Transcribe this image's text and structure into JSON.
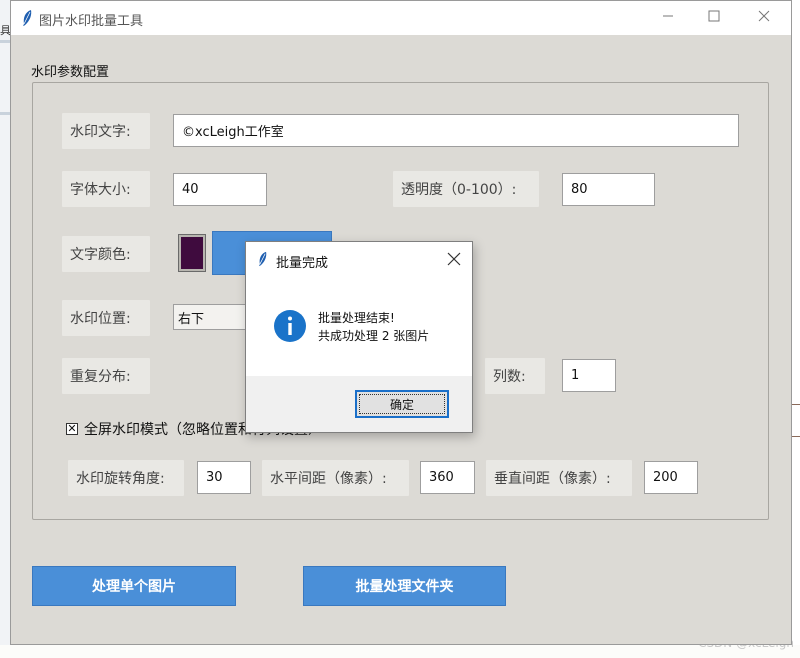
{
  "window": {
    "title": "图片水印批量工具",
    "minimize_icon": "minimize-icon",
    "maximize_icon": "maximize-icon",
    "close_icon": "close-icon"
  },
  "config": {
    "group_title": "水印参数配置",
    "text_label": "水印文字:",
    "text_value": "©xcLeigh工作室",
    "font_size_label": "字体大小:",
    "font_size_value": "40",
    "opacity_label": "透明度（0-100）:",
    "opacity_value": "80",
    "color_label": "文字颜色:",
    "color_swatch": "#3f0b3e",
    "position_label": "水印位置:",
    "position_value": "右下",
    "repeat_label": "重复分布:",
    "columns_label": "列数:",
    "columns_value": "1",
    "fullscreen_checked": true,
    "fullscreen_label": "全屏水印模式（忽略位置和行列设置）",
    "rotation_label": "水印旋转角度:",
    "rotation_value": "30",
    "h_spacing_label": "水平间距（像素）:",
    "h_spacing_value": "360",
    "v_spacing_label": "垂直间距（像素）:",
    "v_spacing_value": "200"
  },
  "actions": {
    "single_label": "处理单个图片",
    "batch_label": "批量处理文件夹"
  },
  "dialog": {
    "title": "批量完成",
    "line1": "批量处理结束!",
    "line2": "共成功处理 2 张图片",
    "ok_label": "确定"
  },
  "watermark_text": "CSDN @xcLeigh",
  "desktop_left_text": "具"
}
